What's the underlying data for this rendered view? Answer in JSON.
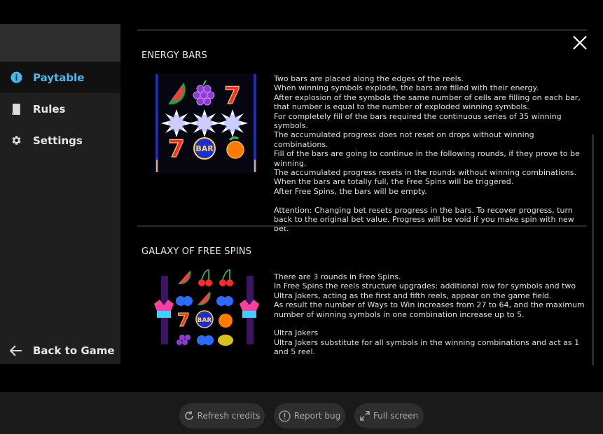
{
  "sidebar": {
    "items": [
      {
        "label": "Paytable",
        "icon": "info-icon",
        "active": true
      },
      {
        "label": "Rules",
        "icon": "book-icon",
        "active": false
      },
      {
        "label": "Settings",
        "icon": "gear-icon",
        "active": false
      }
    ],
    "back_label": "Back to Game",
    "accent_color": "#4cb8ee"
  },
  "sections": {
    "energy": {
      "title": "ENERGY BARS",
      "paragraphs": [
        "Two bars are placed along the edges of the reels.",
        "When winning symbols explode, the bars are filled with their energy.",
        "After explosion of the symbols the same number of cells are filling on each bar, that number is equal to the number of exploded winning symbols.",
        "For completely fill of the bars required the continuous series of 35 winning symbols.",
        "The accumulated progress does not reset on drops without winning combinations.",
        "Fill of the bars are going to continue in the following rounds, if they prove to be winning.",
        "The accumulated progress resets in the rounds without winning combinations.",
        "When the bars are totally full, the Free Spins will be triggered.",
        "After Free Spins, the bars will be empty."
      ],
      "attention": "Attention: Changing bet resets progress in the bars. To recover progress, turn back to the original bet value. Progress will be void if you make spin with new bet."
    },
    "galaxy": {
      "title": "GALAXY OF FREE SPINS",
      "paragraphs": [
        "There are 3 rounds in Free Spins.",
        "In Free Spins the reels structure upgrades: additional row for symbols and two Ultra Jokers, acting as the first and fifth reels, appear on the game field.",
        "As result the number of Ways to Win increases from 27 to 64, and the maximum number of winning symbols in one combination increase up to 5."
      ],
      "subheading": "Ultra Jokers",
      "sub_paragraphs": [
        "Ultra Jokers substitute for all symbols in the winning combinations and act as 1 and 5 reel."
      ]
    }
  },
  "symbols": {
    "bar_label": "BAR",
    "seven_label": "7"
  },
  "footer": {
    "refresh_label": "Refresh credits",
    "report_label": "Report bug",
    "fullscreen_label": "Full screen"
  }
}
